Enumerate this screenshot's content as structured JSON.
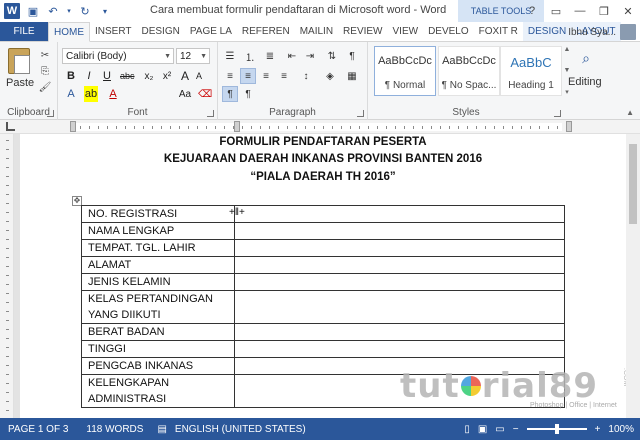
{
  "titlebar": {
    "title": "Cara membuat formulir pendaftaran di Microsoft word - Word",
    "table_tools": "TABLE TOOLS",
    "help": "?",
    "minimize": "—",
    "maximize": "❐",
    "close": "✕"
  },
  "tabs": {
    "file": "FILE",
    "home": "HOME",
    "insert": "INSERT",
    "design": "DESIGN",
    "page_layout": "PAGE LA",
    "references": "REFEREN",
    "mailings": "MAILIN",
    "review": "REVIEW",
    "view": "VIEW",
    "developer": "DEVELO",
    "foxit": "FOXIT R",
    "table_design": "DESIGN",
    "table_layout": "LAYOUT",
    "user_name": "Ibnu Sya..."
  },
  "ribbon": {
    "clipboard": {
      "paste_label": "Paste",
      "group_label": "Clipboard"
    },
    "font": {
      "font_name": "Calibri (Body)",
      "font_size": "12",
      "bold": "B",
      "italic": "I",
      "underline": "U",
      "strikethrough": "abc",
      "subscript": "x₂",
      "superscript": "x²",
      "font_color": "A",
      "grow": "A",
      "shrink": "A",
      "change_case": "Aa",
      "group_label": "Font"
    },
    "paragraph": {
      "group_label": "Paragraph"
    },
    "styles": {
      "items": [
        {
          "sample": "AaBbCcDc",
          "name": "¶ Normal"
        },
        {
          "sample": "AaBbCcDc",
          "name": "¶ No Spac..."
        },
        {
          "sample": "AaBbC",
          "name": "Heading 1"
        }
      ],
      "group_label": "Styles"
    },
    "editing": {
      "label": "Editing"
    }
  },
  "document": {
    "title_lines": [
      "FORMULIR PENDAFTARAN PESERTA",
      "KEJUARAAN DAERAH INKANAS PROVINSI BANTEN 2016",
      "“PIALA DAERAH TH 2016”"
    ],
    "table_rows": [
      {
        "label": "NO. REGISTRASI",
        "value": ""
      },
      {
        "label": "NAMA LENGKAP",
        "value": ""
      },
      {
        "label": "TEMPAT. TGL. LAHIR",
        "value": ""
      },
      {
        "label": "ALAMAT",
        "value": ""
      },
      {
        "label": "JENIS KELAMIN",
        "value": ""
      },
      {
        "label": "KELAS PERTANDINGAN\nYANG DIIKUTI",
        "value": ""
      },
      {
        "label": "BERAT BADAN",
        "value": ""
      },
      {
        "label": "TINGGI",
        "value": ""
      },
      {
        "label": "PENGCAB INKANAS",
        "value": ""
      },
      {
        "label": "KELENGKAPAN\nADMINISTRASI",
        "value": ""
      }
    ]
  },
  "watermark": {
    "text_left": "tut",
    "text_right": "rial89",
    "sub": "Photoshop | Office | Internet",
    "com": ".COM"
  },
  "statusbar": {
    "page": "PAGE 1 OF 3",
    "words": "118 WORDS",
    "language": "ENGLISH (UNITED STATES)",
    "zoom": "100%",
    "zoom_minus": "−",
    "zoom_plus": "+"
  }
}
